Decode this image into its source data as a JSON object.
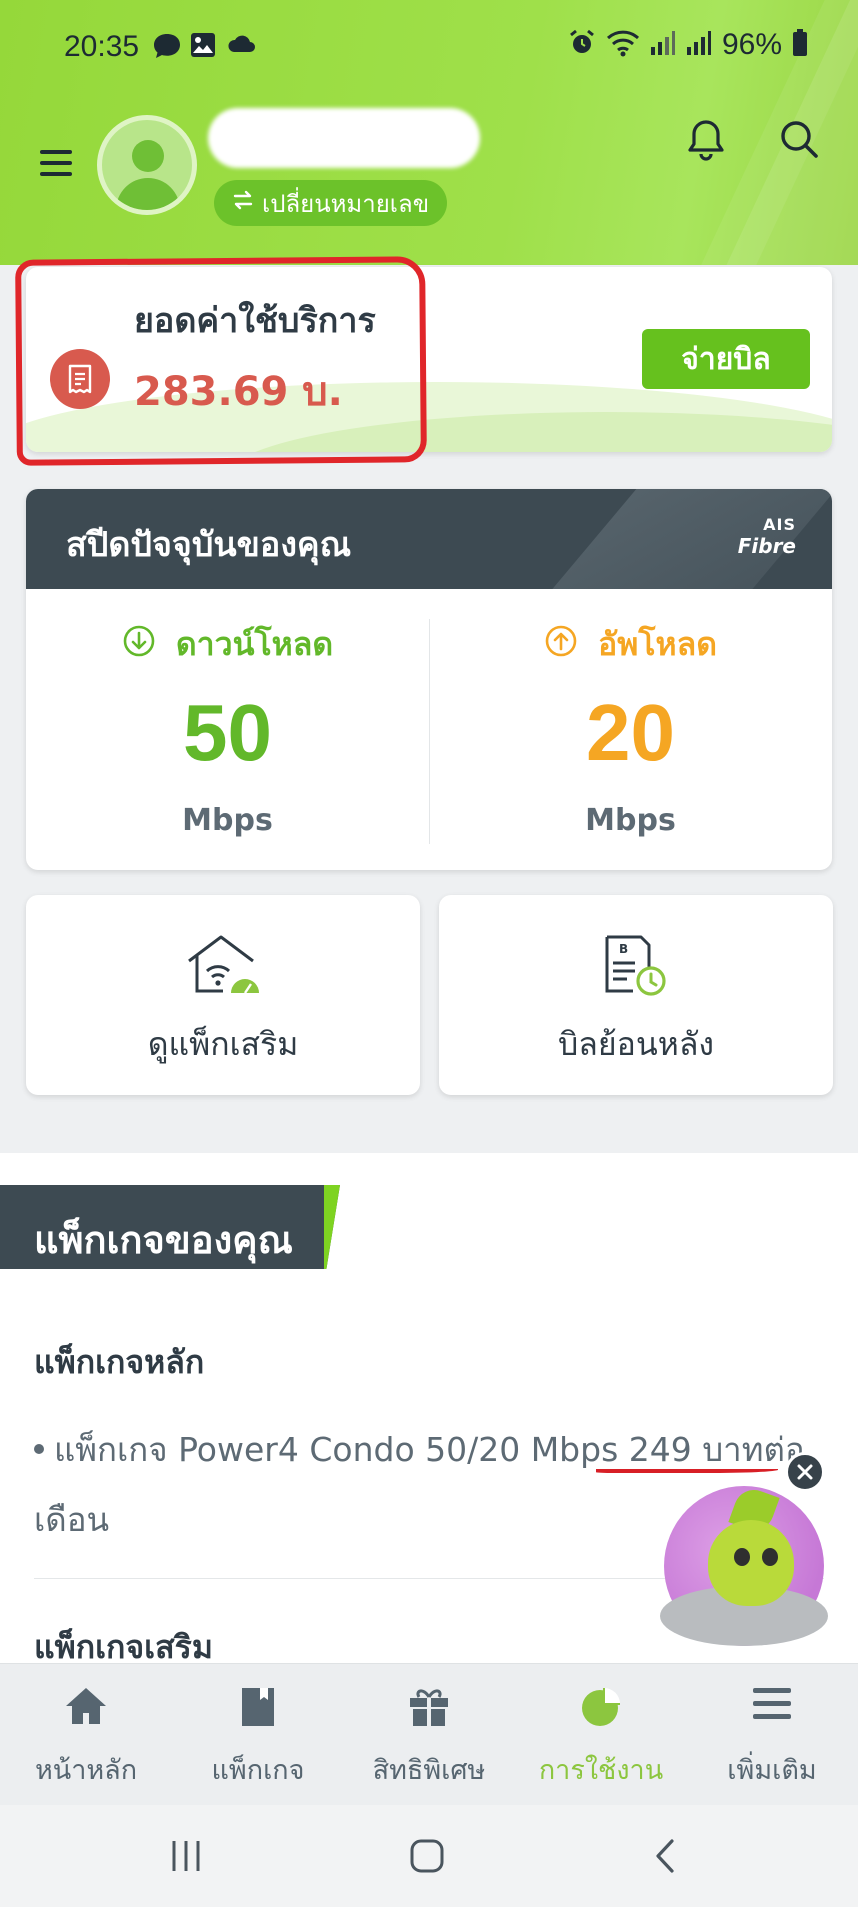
{
  "status_bar": {
    "time": "20:35",
    "battery": "96%",
    "left_icons": [
      "chat-bubble-icon",
      "gallery-icon",
      "cloud-icon"
    ],
    "right_icons": [
      "alarm-icon",
      "wifi-icon",
      "signal-icon",
      "signal-icon",
      "battery-icon"
    ]
  },
  "header": {
    "switch_number_label": "เปลี่ยนหมายเลข",
    "icons": [
      "menu-icon",
      "avatar",
      "bell-icon",
      "search-icon"
    ]
  },
  "bill": {
    "title": "ยอดค่าใช้บริการ",
    "amount": "283.69 บ.",
    "pay_button": "จ่ายบิล"
  },
  "speed": {
    "title": "สปีดปัจจุบันของคุณ",
    "logo_top": "AIS",
    "logo_bottom": "Fibre",
    "download": {
      "label": "ดาวน์โหลด",
      "value": "50",
      "unit": "Mbps"
    },
    "upload": {
      "label": "อัพโหลด",
      "value": "20",
      "unit": "Mbps"
    }
  },
  "tiles": [
    {
      "label": "ดูแพ็กเสริม",
      "icon": "home-wifi-speed-icon"
    },
    {
      "label": "บิลย้อนหลัง",
      "icon": "bill-history-icon"
    }
  ],
  "packages": {
    "section_title": "แพ็กเกจของคุณ",
    "main_title": "แพ็กเกจหลัก",
    "main_item": "แพ็กเกจ Power4 Condo 50/20 Mbps 249 บาทต่อเดือน",
    "extra_title": "แพ็กเกจเสริม"
  },
  "bottom_nav": {
    "items": [
      {
        "label": "หน้าหลัก",
        "icon": "home-icon"
      },
      {
        "label": "แพ็กเกจ",
        "icon": "package-icon"
      },
      {
        "label": "สิทธิพิเศษ",
        "icon": "gift-icon"
      },
      {
        "label": "การใช้งาน",
        "icon": "usage-pie-icon"
      },
      {
        "label": "เพิ่มเติม",
        "icon": "more-menu-icon"
      }
    ],
    "active_index": 3
  },
  "colors": {
    "brand_green": "#95d83a",
    "pay_green": "#66c11e",
    "bill_red": "#d85a4e",
    "download_green": "#62b82a",
    "upload_orange": "#f5a623",
    "dark_slate": "#3d4a52",
    "active_nav": "#8cc63f"
  }
}
